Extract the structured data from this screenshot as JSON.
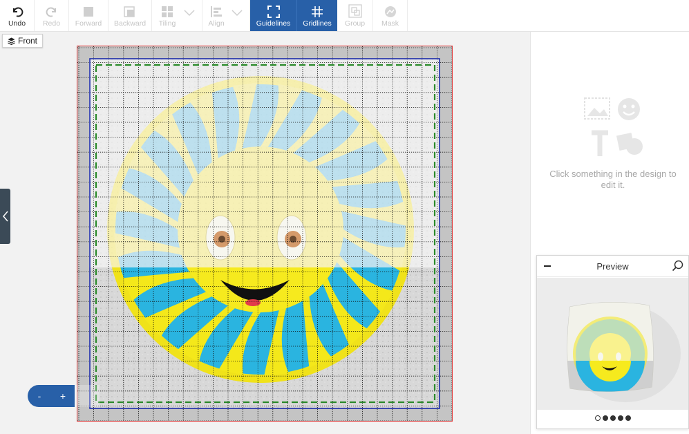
{
  "toolbar": {
    "undo": "Undo",
    "redo": "Redo",
    "forward": "Forward",
    "backward": "Backward",
    "tiling": "Tiling",
    "align": "Align",
    "guidelines": "Guidelines",
    "gridlines": "Gridlines",
    "group": "Group",
    "mask": "Mask"
  },
  "side": {
    "front_label": "Front"
  },
  "zoom": {
    "minus": "-",
    "plus": "+"
  },
  "panel": {
    "empty_message": "Click something in the design to edit it."
  },
  "preview": {
    "title": "Preview",
    "dots_total": 5,
    "dot_selected": 1
  },
  "colors": {
    "accent": "#2860a8",
    "safe_area": "#2a8a2a",
    "bleed": "#1a2aa8",
    "trim": "#e03a3a",
    "sun_yellow": "#f4e81a",
    "sun_blue": "#2ab4e0"
  },
  "icons": [
    "undo-icon",
    "redo-icon",
    "forward-icon",
    "backward-icon",
    "tiling-icon",
    "align-icon",
    "guidelines-icon",
    "gridlines-icon",
    "group-icon",
    "mask-icon",
    "layers-icon",
    "chevron-left-icon",
    "search-icon",
    "minimize-icon"
  ]
}
